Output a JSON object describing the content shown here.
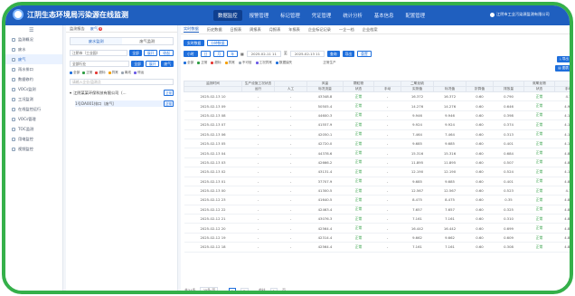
{
  "app": {
    "title": "江阴生态环境局污染源在线监测",
    "user": "江阴市工业污染源监测有限公司"
  },
  "nav": [
    "数据监控",
    "报警管理",
    "标记管理",
    "凭证管理",
    "统计分析",
    "基本信息",
    "配置管理"
  ],
  "sidebar": [
    {
      "label": "监测概况"
    },
    {
      "label": "废水"
    },
    {
      "label": "废气"
    },
    {
      "label": "雨水排口"
    },
    {
      "label": "数据修约"
    },
    {
      "label": "VOCs监测"
    },
    {
      "label": "工况监测"
    },
    {
      "label": "在线监控运行"
    },
    {
      "label": "VOCs管理"
    },
    {
      "label": "TOC监测"
    },
    {
      "label": "用电监控"
    },
    {
      "label": "视频监控"
    }
  ],
  "tree": {
    "tabs": [
      {
        "label": "监测报告"
      },
      {
        "label": "废气",
        "badge": "9"
      }
    ],
    "subtabs": [
      "废水监测",
      "废气监测"
    ],
    "region_select": "江阴市（工业园）",
    "btn_all": "全部",
    "btn_expand": "展开",
    "btn_collapse": "收起",
    "industry_select": "全部行业",
    "btn_gas": "废气",
    "legend": [
      {
        "label": "全部",
        "color": "#1f6fdc"
      },
      {
        "label": "正常",
        "color": "#2f9e44"
      },
      {
        "label": "超标",
        "color": "#e53935"
      },
      {
        "label": "异常",
        "color": "#f59f00"
      },
      {
        "label": "离线",
        "color": "#9aa5b1"
      },
      {
        "label": "停运",
        "color": "#6c5ce7"
      }
    ],
    "search_placeholder": "请输入企业/监测点",
    "company": "江阴某某环保科技有限公司（...",
    "company_tag": "正常",
    "point": "1号DA001排口（废气）",
    "point_tag": "正常"
  },
  "main": {
    "tabs": [
      "实时数据",
      "历史数据",
      "日报表",
      "周报表",
      "月报表",
      "年报表",
      "企业标记记录",
      "一企一档",
      "企业档案"
    ],
    "period_btns": [
      "实时数据",
      "分钟数据"
    ],
    "segs": [
      "小时",
      "日",
      "月",
      "年"
    ],
    "date_from": "2025-02-11 11",
    "date_to": "2025-02-13 11",
    "query": "查询",
    "export": "导出",
    "reset": "重置",
    "filters": [
      "全部",
      "正常",
      "超标",
      "异常",
      "不可信",
      "工况异常",
      "数据缺失"
    ],
    "status_label": "正常生产",
    "right_buttons": [
      "导出",
      "图表"
    ]
  },
  "table": {
    "group_headers": [
      "监测时间",
      "生产设施工况状态",
      "",
      "风量",
      "颗粒物",
      "",
      "二氧化硫",
      "",
      "",
      "",
      "氮氧化物",
      ""
    ],
    "sub_headers": [
      "",
      "运行",
      "人工",
      "标况流量",
      "状态",
      "手动",
      "实测值",
      "标况值",
      "折算值",
      "排放量",
      "状态",
      "手动"
    ],
    "rows": [
      [
        "2025-02-13 10",
        "-",
        "-",
        "43348.8",
        "正常",
        "-",
        "16.372",
        "16.372",
        "0.60",
        "0.790",
        "正常",
        "4.1"
      ],
      [
        "2025-02-13 09",
        "-",
        "-",
        "50505.4",
        "正常",
        "-",
        "14.276",
        "14.276",
        "0.60",
        "0.646",
        "正常",
        "4.91"
      ],
      [
        "2025-02-13 08",
        "-",
        "-",
        "44600.3",
        "正常",
        "-",
        "9.946",
        "9.946",
        "0.60",
        "0.398",
        "正常",
        "4.13"
      ],
      [
        "2025-02-13 07",
        "-",
        "-",
        "41557.9",
        "正常",
        "-",
        "9.924",
        "9.924",
        "0.60",
        "0.374",
        "正常",
        "4.18"
      ],
      [
        "2025-02-13 06",
        "-",
        "-",
        "42050.1",
        "正常",
        "-",
        "7.464",
        "7.464",
        "0.60",
        "0.313",
        "正常",
        "4.14"
      ],
      [
        "2025-02-13 05",
        "-",
        "-",
        "42720.0",
        "正常",
        "-",
        "9.685",
        "9.685",
        "0.60",
        "0.401",
        "正常",
        "4.15"
      ],
      [
        "2025-02-13 04",
        "-",
        "-",
        "44378.6",
        "正常",
        "-",
        "15.316",
        "15.316",
        "0.60",
        "0.684",
        "正常",
        "4.84"
      ],
      [
        "2025-02-13 03",
        "-",
        "-",
        "42666.2",
        "正常",
        "-",
        "11.895",
        "11.895",
        "0.60",
        "0.507",
        "正常",
        "4.84"
      ],
      [
        "2025-02-13 02",
        "-",
        "-",
        "43131.4",
        "正常",
        "-",
        "12.190",
        "12.190",
        "0.60",
        "0.524",
        "正常",
        "4.12"
      ],
      [
        "2025-02-13 01",
        "-",
        "-",
        "37707.9",
        "正常",
        "-",
        "9.685",
        "9.685",
        "0.60",
        "0.401",
        "正常",
        "4.85"
      ],
      [
        "2025-02-13 00",
        "-",
        "-",
        "41300.5",
        "正常",
        "-",
        "12.567",
        "12.567",
        "0.60",
        "0.523",
        "正常",
        "4.1"
      ],
      [
        "2025-02-12 23",
        "-",
        "-",
        "41640.5",
        "正常",
        "-",
        "8.475",
        "8.475",
        "0.60",
        "0.35",
        "正常",
        "4.85"
      ],
      [
        "2025-02-12 22",
        "-",
        "-",
        "42463.4",
        "正常",
        "-",
        "7.657",
        "7.657",
        "0.60",
        "0.325",
        "正常",
        "4.84"
      ],
      [
        "2025-02-12 21",
        "-",
        "-",
        "43076.3",
        "正常",
        "-",
        "7.161",
        "7.161",
        "0.60",
        "0.310",
        "正常",
        "4.85"
      ],
      [
        "2025-02-12 20",
        "-",
        "-",
        "42564.4",
        "正常",
        "-",
        "16.442",
        "16.442",
        "0.60",
        "0.699",
        "正常",
        "4.85"
      ],
      [
        "2025-02-12 19",
        "-",
        "-",
        "42314.4",
        "正常",
        "-",
        "9.662",
        "9.662",
        "0.60",
        "0.609",
        "正常",
        "4.83"
      ],
      [
        "2025-02-12 18",
        "-",
        "-",
        "42564.4",
        "正常",
        "-",
        "7.161",
        "7.161",
        "0.60",
        "0.308",
        "正常",
        "4.85"
      ]
    ]
  },
  "pager": {
    "total": "共34条",
    "page_size": "25条/页",
    "prev": "‹",
    "p1": "1",
    "p2": "2",
    "next": "›",
    "goto": "前往",
    "page_unit": "页"
  }
}
